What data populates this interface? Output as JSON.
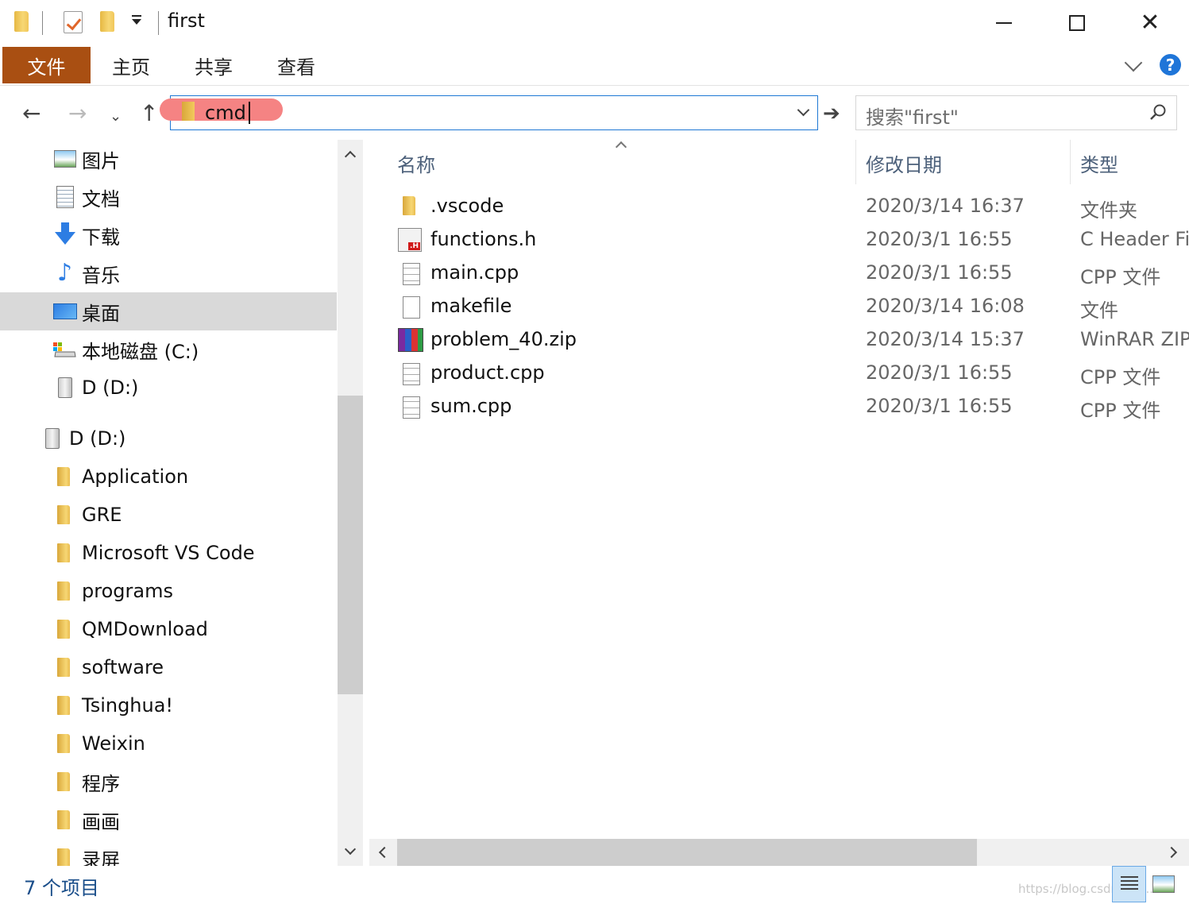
{
  "window": {
    "title": "first"
  },
  "ribbon": {
    "tabs": [
      "文件",
      "主页",
      "共享",
      "查看"
    ],
    "help_label": "?"
  },
  "address_bar": {
    "value": "cmd",
    "search_placeholder": "搜索\"first\""
  },
  "nav_pane": {
    "items": [
      {
        "label": "图片",
        "icon": "pictures-icon"
      },
      {
        "label": "文档",
        "icon": "documents-icon"
      },
      {
        "label": "下载",
        "icon": "download-icon"
      },
      {
        "label": "音乐",
        "icon": "music-icon"
      },
      {
        "label": "桌面",
        "icon": "desktop-icon",
        "selected": true
      },
      {
        "label": "本地磁盘 (C:)",
        "icon": "drive-c-icon"
      },
      {
        "label": "D (D:)",
        "icon": "drive-icon"
      },
      {
        "label": "D (D:)",
        "icon": "drive-icon"
      },
      {
        "label": "Application",
        "icon": "folder-icon"
      },
      {
        "label": "GRE",
        "icon": "folder-icon"
      },
      {
        "label": "Microsoft VS Code",
        "icon": "folder-icon"
      },
      {
        "label": "programs",
        "icon": "folder-icon"
      },
      {
        "label": "QMDownload",
        "icon": "folder-icon"
      },
      {
        "label": "software",
        "icon": "folder-icon"
      },
      {
        "label": "Tsinghua!",
        "icon": "folder-icon"
      },
      {
        "label": "Weixin",
        "icon": "folder-icon"
      },
      {
        "label": "程序",
        "icon": "folder-icon"
      },
      {
        "label": "画画",
        "icon": "folder-icon"
      },
      {
        "label": "录屏",
        "icon": "folder-icon"
      }
    ]
  },
  "file_list": {
    "columns": [
      "名称",
      "修改日期",
      "类型"
    ],
    "rows": [
      {
        "name": ".vscode",
        "date": "2020/3/14 16:37",
        "type": "文件夹",
        "icon": "folder-icon"
      },
      {
        "name": "functions.h",
        "date": "2020/3/1 16:55",
        "type": "C Header Fi",
        "icon": "h-file-icon"
      },
      {
        "name": "main.cpp",
        "date": "2020/3/1 16:55",
        "type": "CPP 文件",
        "icon": "cpp-file-icon"
      },
      {
        "name": "makefile",
        "date": "2020/3/14 16:08",
        "type": "文件",
        "icon": "file-icon"
      },
      {
        "name": "problem_40.zip",
        "date": "2020/3/14 15:37",
        "type": "WinRAR ZIP",
        "icon": "winrar-icon"
      },
      {
        "name": "product.cpp",
        "date": "2020/3/1 16:55",
        "type": "CPP 文件",
        "icon": "cpp-file-icon"
      },
      {
        "name": "sum.cpp",
        "date": "2020/3/1 16:55",
        "type": "CPP 文件",
        "icon": "cpp-file-icon"
      }
    ]
  },
  "status_bar": {
    "item_count": "7 个项目",
    "watermark": "https://blog.csdn.net/..."
  },
  "colors": {
    "file_tab": "#a94f12",
    "accent": "#1e78d4",
    "address_highlight": "#f58383",
    "selection": "#d9d9d9"
  }
}
